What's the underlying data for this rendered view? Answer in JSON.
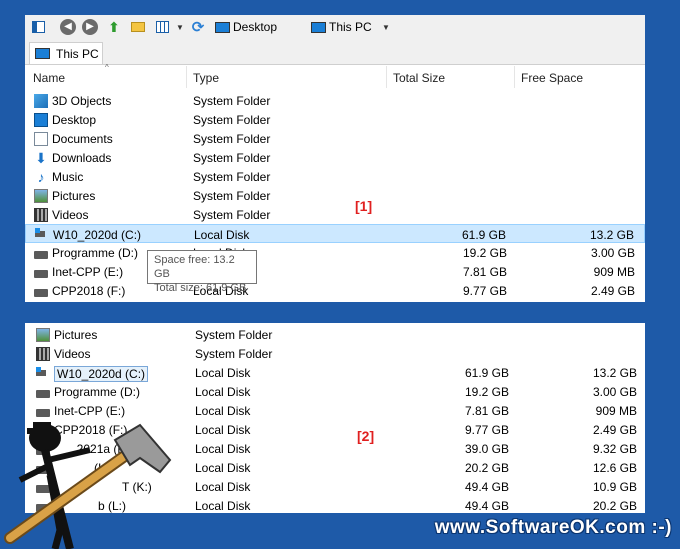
{
  "toolbar": {
    "location1": "Desktop",
    "location2": "This PC"
  },
  "tab": {
    "label": "This PC"
  },
  "columns": {
    "name": "Name",
    "type": "Type",
    "total": "Total Size",
    "free": "Free Space"
  },
  "panel1": {
    "rows": [
      {
        "name": "3D Objects",
        "type": "System Folder",
        "total": "",
        "free": ""
      },
      {
        "name": "Desktop",
        "type": "System Folder",
        "total": "",
        "free": ""
      },
      {
        "name": "Documents",
        "type": "System Folder",
        "total": "",
        "free": ""
      },
      {
        "name": "Downloads",
        "type": "System Folder",
        "total": "",
        "free": ""
      },
      {
        "name": "Music",
        "type": "System Folder",
        "total": "",
        "free": ""
      },
      {
        "name": "Pictures",
        "type": "System Folder",
        "total": "",
        "free": ""
      },
      {
        "name": "Videos",
        "type": "System Folder",
        "total": "",
        "free": ""
      },
      {
        "name": "W10_2020d (C:)",
        "type": "Local Disk",
        "total": "61.9 GB",
        "free": "13.2 GB"
      },
      {
        "name": "Programme (D:)",
        "type": "Local Disk",
        "total": "19.2 GB",
        "free": "3.00 GB"
      },
      {
        "name": "Inet-CPP (E:)",
        "type": "Local Disk",
        "total": "7.81 GB",
        "free": "909 MB"
      },
      {
        "name": "CPP2018 (F:)",
        "type": "Local Disk",
        "total": "9.77 GB",
        "free": "2.49 GB"
      }
    ],
    "marker": "[1]",
    "tooltip": {
      "line1": "Space free: 13.2 GB",
      "line2": "Total size: 61.9 GB"
    }
  },
  "panel2": {
    "rows": [
      {
        "name": "Pictures",
        "type": "System Folder",
        "total": "",
        "free": ""
      },
      {
        "name": "Videos",
        "type": "System Folder",
        "total": "",
        "free": ""
      },
      {
        "name": "W10_2020d (C:)",
        "type": "Local Disk",
        "total": "61.9 GB",
        "free": "13.2 GB"
      },
      {
        "name": "Programme (D:)",
        "type": "Local Disk",
        "total": "19.2 GB",
        "free": "3.00 GB"
      },
      {
        "name": "Inet-CPP (E:)",
        "type": "Local Disk",
        "total": "7.81 GB",
        "free": "909 MB"
      },
      {
        "name": "CPP2018 (F:)",
        "type": "Local Disk",
        "total": "9.77 GB",
        "free": "2.49 GB"
      },
      {
        "name": "_2021a (H:)",
        "type": "Local Disk",
        "total": "39.0 GB",
        "free": "9.32 GB"
      },
      {
        "name": "(I:)",
        "type": "Local Disk",
        "total": "20.2 GB",
        "free": "12.6 GB"
      },
      {
        "name": "T (K:)",
        "type": "Local Disk",
        "total": "49.4 GB",
        "free": "10.9 GB"
      },
      {
        "name": "b (L:)",
        "type": "Local Disk",
        "total": "49.4 GB",
        "free": "20.2 GB"
      }
    ],
    "marker": "[2]"
  },
  "watermark": "www.SoftwareOK.com :-)"
}
